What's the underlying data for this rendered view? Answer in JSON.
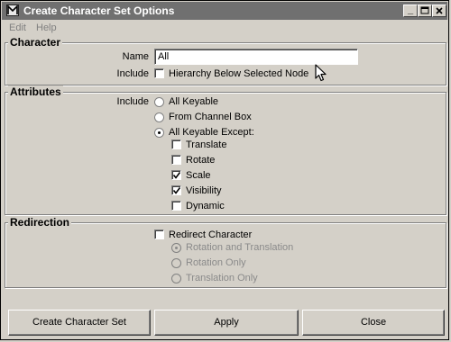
{
  "window": {
    "title": "Create Character Set Options"
  },
  "menu": {
    "items": [
      "Edit",
      "Help"
    ]
  },
  "character": {
    "heading": "Character",
    "name_label": "Name",
    "name_value": "All",
    "include_label": "Include",
    "hierarchy_label": "Hierarchy Below Selected Node",
    "hierarchy_checked": false
  },
  "attributes": {
    "heading": "Attributes",
    "include_label": "Include",
    "options": [
      "All Keyable",
      "From Channel Box",
      "All Keyable Except:"
    ],
    "selected_option": "All Keyable Except:",
    "except": [
      {
        "label": "Translate",
        "checked": false
      },
      {
        "label": "Rotate",
        "checked": false
      },
      {
        "label": "Scale",
        "checked": true
      },
      {
        "label": "Visibility",
        "checked": true
      },
      {
        "label": "Dynamic",
        "checked": false
      }
    ]
  },
  "redirection": {
    "heading": "Redirection",
    "redirect_label": "Redirect Character",
    "redirect_checked": false,
    "options": [
      "Rotation and Translation",
      "Rotation Only",
      "Translation Only"
    ],
    "selected_option": "Rotation and Translation"
  },
  "buttons": {
    "create": "Create Character Set",
    "apply": "Apply",
    "close": "Close"
  }
}
